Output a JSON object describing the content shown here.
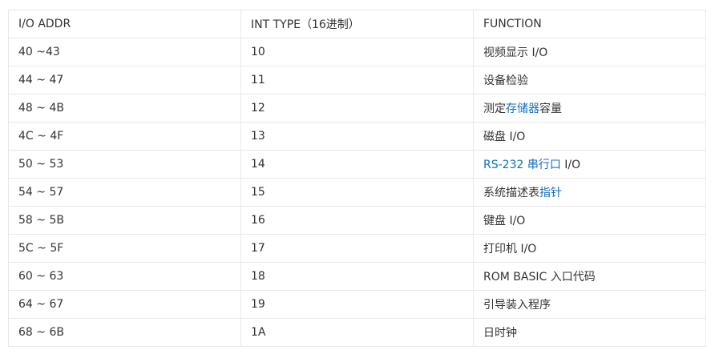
{
  "table": {
    "headers": [
      "I/O ADDR",
      "INT TYPE（16进制）",
      "FUNCTION"
    ],
    "rows": [
      {
        "addr": "40 ~43",
        "type": "10",
        "func": [
          {
            "t": "视频显示 I/O"
          }
        ]
      },
      {
        "addr": "44 ~ 47",
        "type": "11",
        "func": [
          {
            "t": "设备检验"
          }
        ]
      },
      {
        "addr": "48 ~ 4B",
        "type": "12",
        "func": [
          {
            "t": "测定"
          },
          {
            "t": "存储器",
            "link": true
          },
          {
            "t": "容量"
          }
        ]
      },
      {
        "addr": "4C ~ 4F",
        "type": "13",
        "func": [
          {
            "t": "磁盘 I/O"
          }
        ]
      },
      {
        "addr": "50 ~ 53",
        "type": "14",
        "func": [
          {
            "t": "RS-232 串行口",
            "link": true
          },
          {
            "t": " I/O"
          }
        ]
      },
      {
        "addr": "54 ~ 57",
        "type": "15",
        "func": [
          {
            "t": "系统描述表"
          },
          {
            "t": "指针",
            "link": true
          }
        ]
      },
      {
        "addr": "58 ~ 5B",
        "type": "16",
        "func": [
          {
            "t": "键盘 I/O"
          }
        ]
      },
      {
        "addr": "5C ~ 5F",
        "type": "17",
        "func": [
          {
            "t": "打印机 I/O"
          }
        ]
      },
      {
        "addr": "60 ~ 63",
        "type": "18",
        "func": [
          {
            "t": "ROM BASIC 入口代码"
          }
        ]
      },
      {
        "addr": "64 ~ 67",
        "type": "19",
        "func": [
          {
            "t": "引导装入程序"
          }
        ]
      },
      {
        "addr": "68 ~ 6B",
        "type": "1A",
        "func": [
          {
            "t": "日时钟"
          }
        ]
      }
    ]
  },
  "colors": {
    "link": "#136ec2",
    "text": "#333333",
    "border": "#e8e8e8"
  }
}
